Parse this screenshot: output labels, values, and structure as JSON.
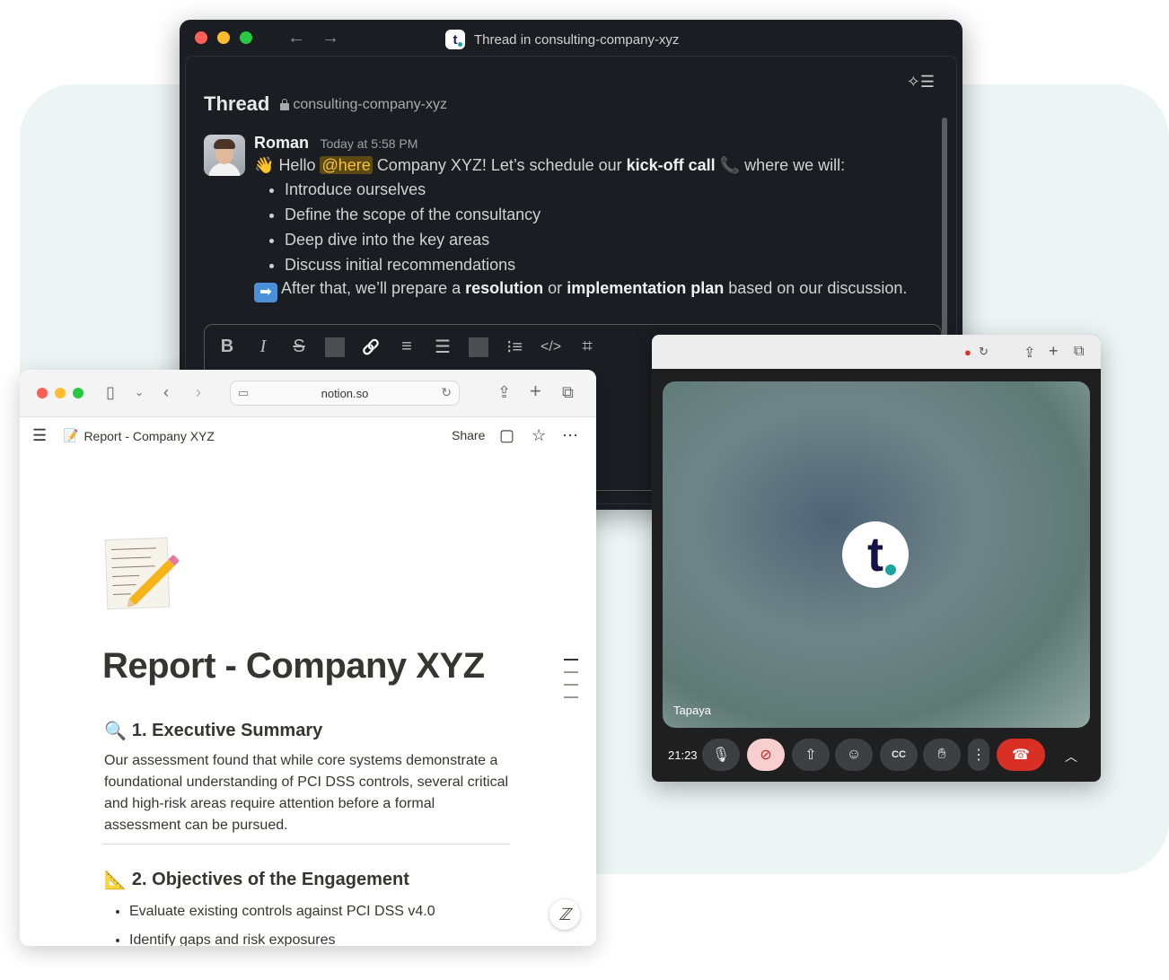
{
  "slack": {
    "window_title": "Thread in consulting-company-xyz",
    "logo_letter": "t",
    "thread_title": "Thread",
    "channel": "consulting-company-xyz",
    "message": {
      "author": "Roman",
      "time": "Today at 5:58 PM",
      "greeting_emoji": "👋",
      "hello": "Hello",
      "mention": "@here",
      "text1": "Company XYZ! Let’s schedule our",
      "bold1": "kick-off call",
      "phone_emoji": "📞",
      "text2": "where we will:",
      "bullets": [
        "Introduce ourselves",
        "Define the scope of the consultancy",
        "Deep dive into the key areas",
        "Discuss initial recommendations"
      ],
      "arrow_emoji": "➡",
      "after1": "After that, we’ll prepare a",
      "bold2": "resolution",
      "after2": "or",
      "bold3": "implementation plan",
      "after3": "based on our discussion."
    },
    "toolbar": {
      "bold": "B",
      "italic": "I",
      "strike": "S",
      "link": "🔗",
      "ordered_list": "≡",
      "bullet_list": "☰",
      "quote": "⁝≡",
      "code": "</>",
      "code_block": "⌗"
    },
    "icons": [
      "sparkle-list-icon",
      "lock-icon",
      "send-icon",
      "chevron-down-icon"
    ]
  },
  "meet": {
    "participant": "Tapaya",
    "logo_letter": "t",
    "clock": "21:23",
    "colors": {
      "end_call": "#d93025",
      "camera_off": "#f7cfcf"
    }
  },
  "notion": {
    "url": "notion.so",
    "breadcrumb_emoji": "📝",
    "breadcrumb": "Report - Company XYZ",
    "share": "Share",
    "page_title": "Report - Company XYZ",
    "sections": [
      {
        "emoji": "🔍",
        "heading": "1. Executive Summary",
        "body": "Our assessment found that while core systems demonstrate a foundational understanding of PCI DSS controls, several critical and high-risk areas require attention before a formal assessment can be pursued."
      },
      {
        "emoji": "📐",
        "heading": "2. Objectives of the Engagement",
        "items": [
          "Evaluate existing controls against PCI DSS v4.0",
          "Identify gaps and risk exposures"
        ]
      }
    ]
  }
}
